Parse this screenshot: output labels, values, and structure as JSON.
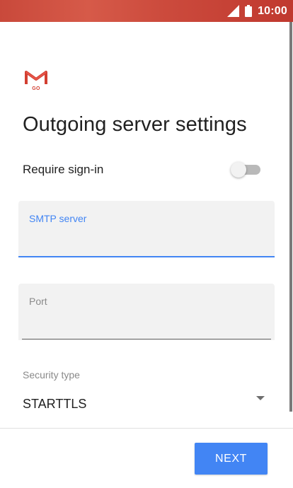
{
  "status_bar": {
    "time": "10:00",
    "signal_icon": "signal-icon",
    "battery_icon": "battery-icon",
    "background_color": "#c9493b"
  },
  "app": {
    "logo_icon": "gmail-go-icon",
    "logo_subtext": "GO"
  },
  "page": {
    "title": "Outgoing server settings"
  },
  "require_signin": {
    "label": "Require sign-in",
    "enabled": false
  },
  "smtp_server": {
    "label": "SMTP server",
    "value": "",
    "focused": true
  },
  "port": {
    "label": "Port",
    "value": ""
  },
  "security_type": {
    "label": "Security type",
    "value": "STARTTLS"
  },
  "footer": {
    "next_label": "NEXT"
  },
  "colors": {
    "accent": "#4285f4",
    "brand_red": "#d23f31"
  }
}
